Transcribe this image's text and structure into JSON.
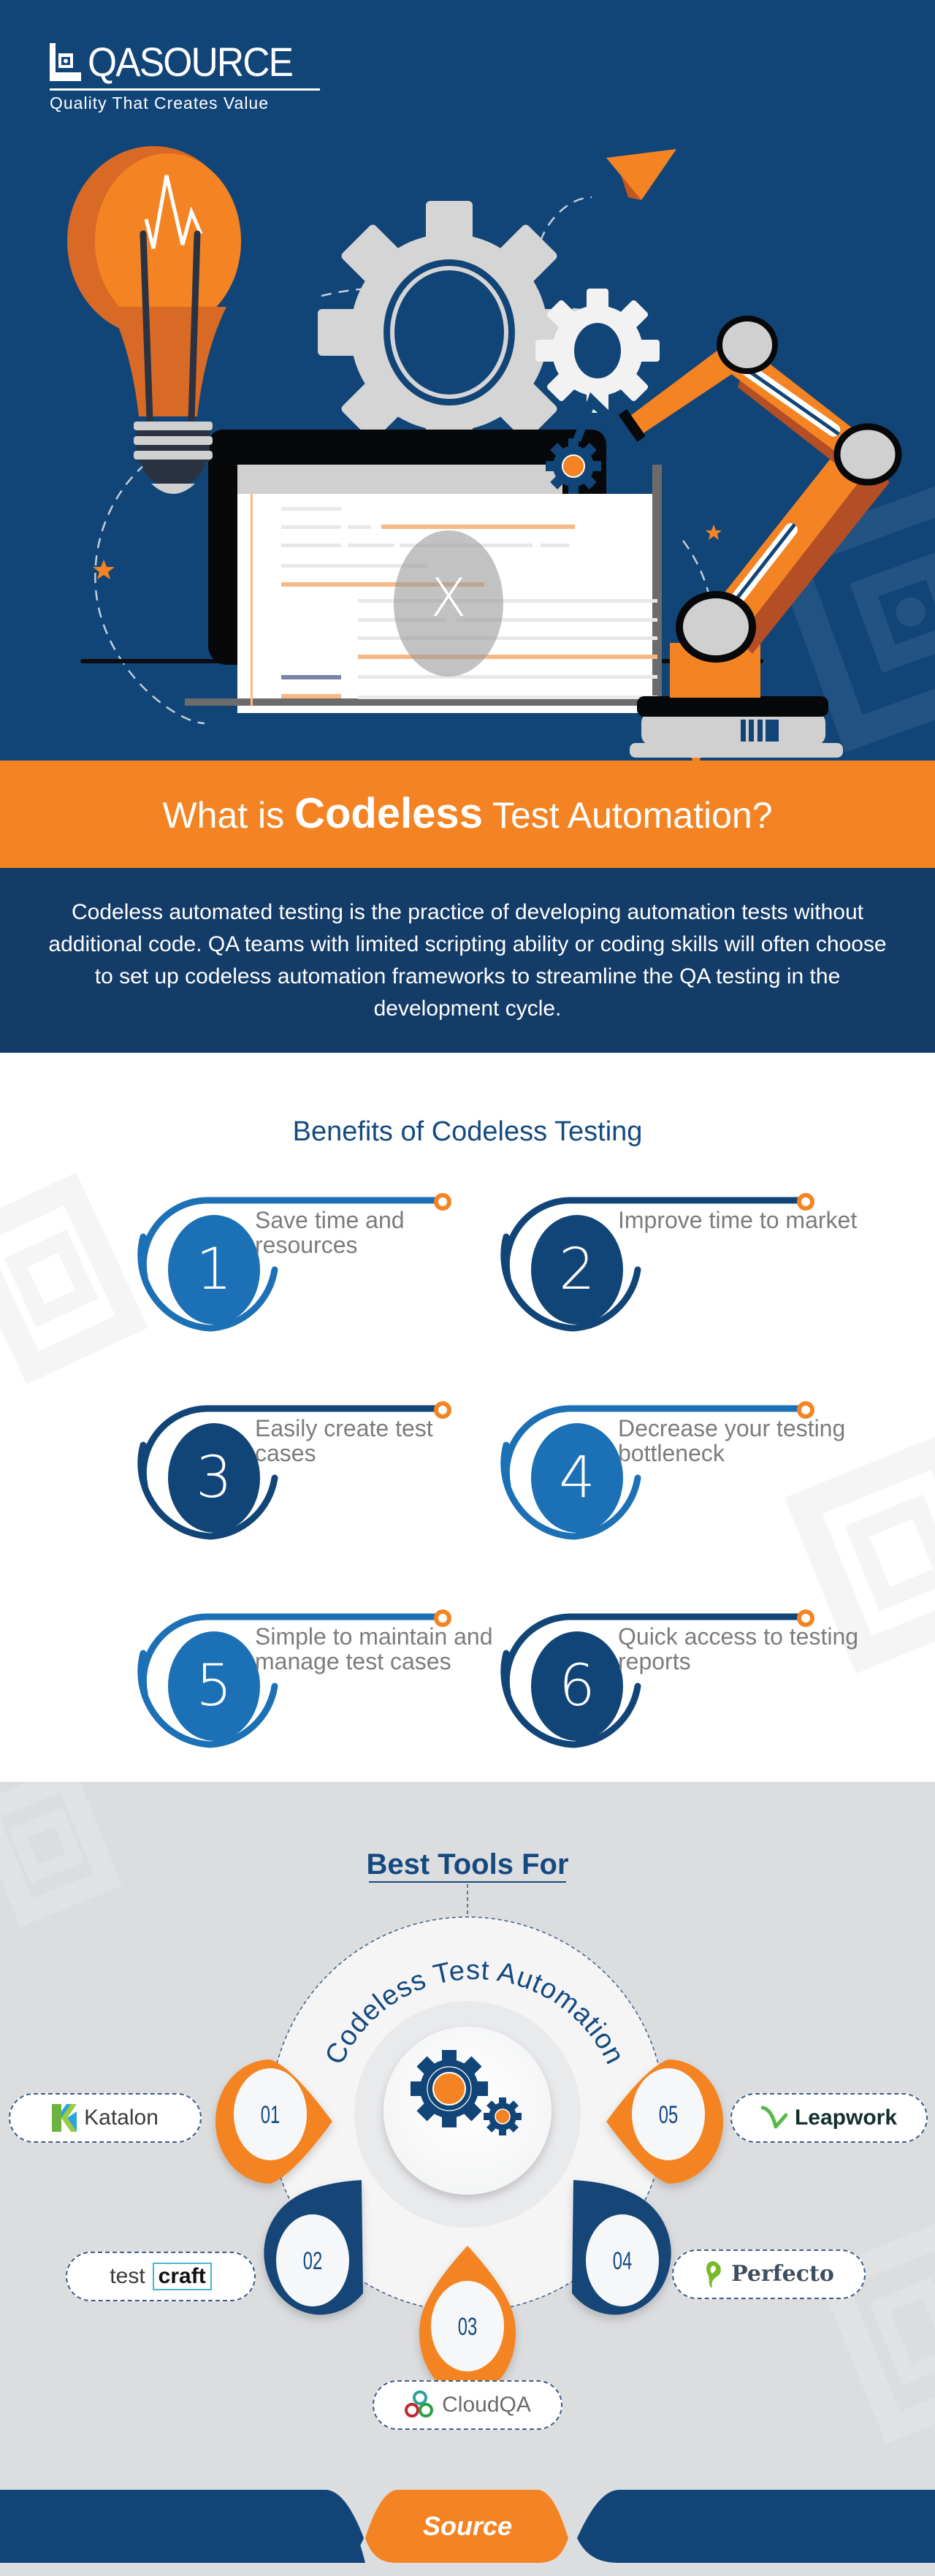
{
  "brand": {
    "name": "QASOURCE",
    "tagline": "Quality That Creates Value"
  },
  "colors": {
    "navy": "#124577",
    "navy_dark": "#143c68",
    "orange": "#f48423",
    "blue_mid": "#1c70b6",
    "gray_bg": "#dcdddf",
    "text_gray": "#7c7c7c"
  },
  "hero": {
    "illustration": "laptop-with-robot-arm-lightbulb-gears",
    "screen_badge": "X"
  },
  "title": {
    "prefix": "What is ",
    "emphasis": "Codeless",
    "suffix": " Test Automation?"
  },
  "intro": {
    "text": "Codeless automated testing is the practice of developing automation tests without additional code. QA teams with limited scripting ability or coding skills will often choose to set up codeless automation frameworks to streamline the QA testing in the development cycle."
  },
  "benefits": {
    "title": "Benefits of Codeless Testing",
    "items": [
      {
        "number": "1",
        "text": "Save time and resources",
        "color": "#1c70b6"
      },
      {
        "number": "2",
        "text": "Improve time to market",
        "color": "#124577"
      },
      {
        "number": "3",
        "text": "Easily create test cases",
        "color": "#124577"
      },
      {
        "number": "4",
        "text": "Decrease your testing bottleneck",
        "color": "#1c70b6"
      },
      {
        "number": "5",
        "text": "Simple to maintain and manage test cases",
        "color": "#1c70b6"
      },
      {
        "number": "6",
        "text": "Quick access to testing reports",
        "color": "#124577"
      }
    ]
  },
  "tools": {
    "title": "Best Tools For",
    "arc_label": "Codeless Test Automation",
    "center_icon": "gears-icon",
    "items": [
      {
        "index": "01",
        "name": "Katalon",
        "pin_color": "#f48423"
      },
      {
        "index": "02",
        "name": "testcraft",
        "name_parts": [
          "test",
          "craft"
        ],
        "pin_color": "#124577"
      },
      {
        "index": "03",
        "name": "CloudQA",
        "pin_color": "#f48423"
      },
      {
        "index": "04",
        "name": "Perfecto",
        "pin_color": "#124577"
      },
      {
        "index": "05",
        "name": "Leapwork",
        "pin_color": "#f48423"
      }
    ]
  },
  "footer": {
    "source_label": "Source"
  }
}
